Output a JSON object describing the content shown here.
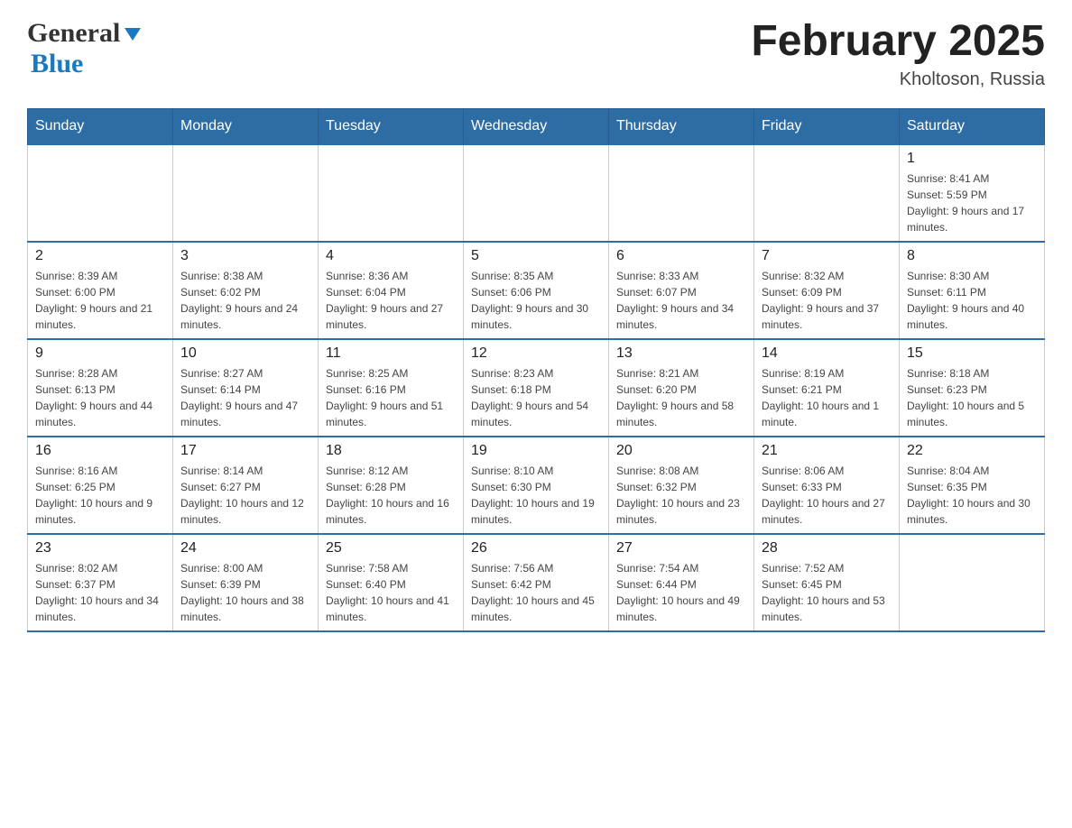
{
  "header": {
    "logo": {
      "general": "General",
      "blue": "Blue"
    },
    "title": "February 2025",
    "location": "Kholtoson, Russia"
  },
  "calendar": {
    "days_of_week": [
      "Sunday",
      "Monday",
      "Tuesday",
      "Wednesday",
      "Thursday",
      "Friday",
      "Saturday"
    ],
    "weeks": [
      {
        "cells": [
          {
            "day": "",
            "info": ""
          },
          {
            "day": "",
            "info": ""
          },
          {
            "day": "",
            "info": ""
          },
          {
            "day": "",
            "info": ""
          },
          {
            "day": "",
            "info": ""
          },
          {
            "day": "",
            "info": ""
          },
          {
            "day": "1",
            "info": "Sunrise: 8:41 AM\nSunset: 5:59 PM\nDaylight: 9 hours and 17 minutes."
          }
        ]
      },
      {
        "cells": [
          {
            "day": "2",
            "info": "Sunrise: 8:39 AM\nSunset: 6:00 PM\nDaylight: 9 hours and 21 minutes."
          },
          {
            "day": "3",
            "info": "Sunrise: 8:38 AM\nSunset: 6:02 PM\nDaylight: 9 hours and 24 minutes."
          },
          {
            "day": "4",
            "info": "Sunrise: 8:36 AM\nSunset: 6:04 PM\nDaylight: 9 hours and 27 minutes."
          },
          {
            "day": "5",
            "info": "Sunrise: 8:35 AM\nSunset: 6:06 PM\nDaylight: 9 hours and 30 minutes."
          },
          {
            "day": "6",
            "info": "Sunrise: 8:33 AM\nSunset: 6:07 PM\nDaylight: 9 hours and 34 minutes."
          },
          {
            "day": "7",
            "info": "Sunrise: 8:32 AM\nSunset: 6:09 PM\nDaylight: 9 hours and 37 minutes."
          },
          {
            "day": "8",
            "info": "Sunrise: 8:30 AM\nSunset: 6:11 PM\nDaylight: 9 hours and 40 minutes."
          }
        ]
      },
      {
        "cells": [
          {
            "day": "9",
            "info": "Sunrise: 8:28 AM\nSunset: 6:13 PM\nDaylight: 9 hours and 44 minutes."
          },
          {
            "day": "10",
            "info": "Sunrise: 8:27 AM\nSunset: 6:14 PM\nDaylight: 9 hours and 47 minutes."
          },
          {
            "day": "11",
            "info": "Sunrise: 8:25 AM\nSunset: 6:16 PM\nDaylight: 9 hours and 51 minutes."
          },
          {
            "day": "12",
            "info": "Sunrise: 8:23 AM\nSunset: 6:18 PM\nDaylight: 9 hours and 54 minutes."
          },
          {
            "day": "13",
            "info": "Sunrise: 8:21 AM\nSunset: 6:20 PM\nDaylight: 9 hours and 58 minutes."
          },
          {
            "day": "14",
            "info": "Sunrise: 8:19 AM\nSunset: 6:21 PM\nDaylight: 10 hours and 1 minute."
          },
          {
            "day": "15",
            "info": "Sunrise: 8:18 AM\nSunset: 6:23 PM\nDaylight: 10 hours and 5 minutes."
          }
        ]
      },
      {
        "cells": [
          {
            "day": "16",
            "info": "Sunrise: 8:16 AM\nSunset: 6:25 PM\nDaylight: 10 hours and 9 minutes."
          },
          {
            "day": "17",
            "info": "Sunrise: 8:14 AM\nSunset: 6:27 PM\nDaylight: 10 hours and 12 minutes."
          },
          {
            "day": "18",
            "info": "Sunrise: 8:12 AM\nSunset: 6:28 PM\nDaylight: 10 hours and 16 minutes."
          },
          {
            "day": "19",
            "info": "Sunrise: 8:10 AM\nSunset: 6:30 PM\nDaylight: 10 hours and 19 minutes."
          },
          {
            "day": "20",
            "info": "Sunrise: 8:08 AM\nSunset: 6:32 PM\nDaylight: 10 hours and 23 minutes."
          },
          {
            "day": "21",
            "info": "Sunrise: 8:06 AM\nSunset: 6:33 PM\nDaylight: 10 hours and 27 minutes."
          },
          {
            "day": "22",
            "info": "Sunrise: 8:04 AM\nSunset: 6:35 PM\nDaylight: 10 hours and 30 minutes."
          }
        ]
      },
      {
        "cells": [
          {
            "day": "23",
            "info": "Sunrise: 8:02 AM\nSunset: 6:37 PM\nDaylight: 10 hours and 34 minutes."
          },
          {
            "day": "24",
            "info": "Sunrise: 8:00 AM\nSunset: 6:39 PM\nDaylight: 10 hours and 38 minutes."
          },
          {
            "day": "25",
            "info": "Sunrise: 7:58 AM\nSunset: 6:40 PM\nDaylight: 10 hours and 41 minutes."
          },
          {
            "day": "26",
            "info": "Sunrise: 7:56 AM\nSunset: 6:42 PM\nDaylight: 10 hours and 45 minutes."
          },
          {
            "day": "27",
            "info": "Sunrise: 7:54 AM\nSunset: 6:44 PM\nDaylight: 10 hours and 49 minutes."
          },
          {
            "day": "28",
            "info": "Sunrise: 7:52 AM\nSunset: 6:45 PM\nDaylight: 10 hours and 53 minutes."
          },
          {
            "day": "",
            "info": ""
          }
        ]
      }
    ]
  }
}
